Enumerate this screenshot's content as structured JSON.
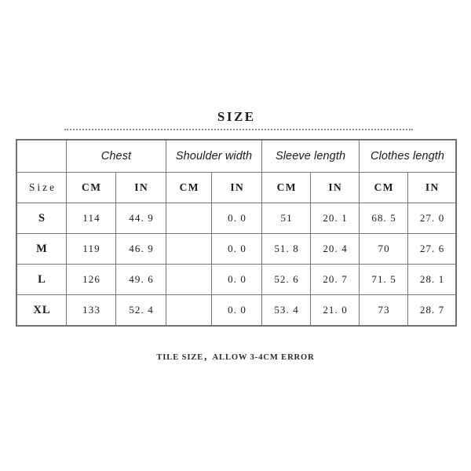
{
  "page": {
    "title": "SIZE",
    "background_color": "#ffffff",
    "divider": "dotted-rule"
  },
  "table": {
    "corner_label": "",
    "size_header_label": "Size",
    "group_headers": [
      "Chest",
      "Shoulder width",
      "Sleeve length",
      "Clothes length"
    ],
    "unit_headers": [
      "CM",
      "IN",
      "CM",
      "IN",
      "CM",
      "IN",
      "CM",
      "IN"
    ],
    "rows": [
      {
        "size": "S",
        "chest_cm": "114",
        "chest_in": "44. 9",
        "shoulder_cm": "",
        "shoulder_in": "0. 0",
        "sleeve_cm": "51",
        "sleeve_in": "20. 1",
        "clothes_cm": "68. 5",
        "clothes_in": "27. 0"
      },
      {
        "size": "M",
        "chest_cm": "119",
        "chest_in": "46. 9",
        "shoulder_cm": "",
        "shoulder_in": "0. 0",
        "sleeve_cm": "51. 8",
        "sleeve_in": "20. 4",
        "clothes_cm": "70",
        "clothes_in": "27. 6"
      },
      {
        "size": "L",
        "chest_cm": "126",
        "chest_in": "49. 6",
        "shoulder_cm": "",
        "shoulder_in": "0. 0",
        "sleeve_cm": "52. 6",
        "sleeve_in": "20. 7",
        "clothes_cm": "71. 5",
        "clothes_in": "28. 1"
      },
      {
        "size": "XL",
        "chest_cm": "133",
        "chest_in": "52. 4",
        "shoulder_cm": "",
        "shoulder_in": "0. 0",
        "sleeve_cm": "53. 4",
        "sleeve_in": "21. 0",
        "clothes_cm": "73",
        "clothes_in": "28. 7"
      }
    ]
  },
  "footer": {
    "note": "TILE SIZE，ALLOW 3-4CM ERROR"
  },
  "colors": {
    "header_beige": "#edeae0",
    "cell_white": "#ffffff",
    "border_gray": "#777777",
    "outer_border_gray": "#6a6a6a",
    "text_dark": "#1b1b1b",
    "dotted_gray": "#8d8d8d"
  }
}
